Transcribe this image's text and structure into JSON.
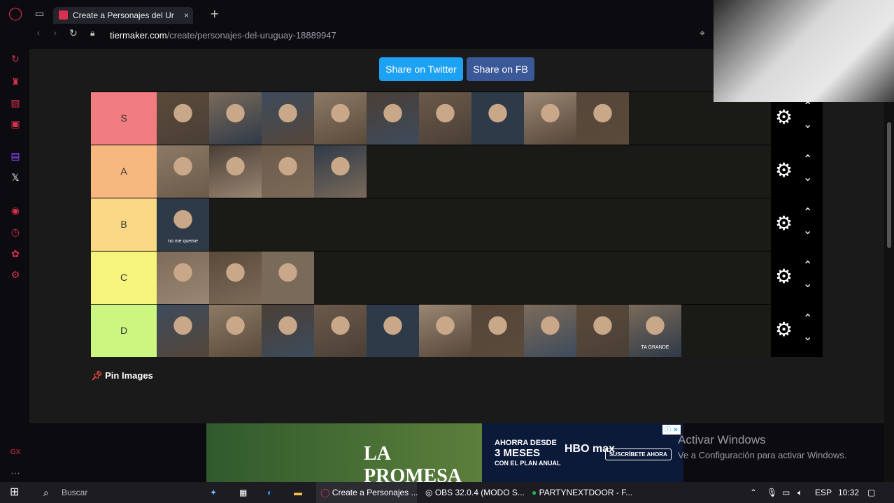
{
  "browser": {
    "tab_title": "Create a Personajes del Ur",
    "url_host": "tiermaker.com",
    "url_path": "/create/personajes-del-uruguay-18889947"
  },
  "page": {
    "share_twitter": "Share on Twitter",
    "share_fb": "Share on FB",
    "pin_images": "Pin Images"
  },
  "tiers": [
    {
      "label": "S",
      "color": "#f17d81",
      "count": 9
    },
    {
      "label": "A",
      "color": "#f7b880",
      "count": 4
    },
    {
      "label": "B",
      "color": "#fad884",
      "count": 1
    },
    {
      "label": "C",
      "color": "#f7f47e",
      "count": 3
    },
    {
      "label": "D",
      "color": "#cdf681",
      "count": 10
    }
  ],
  "thumb_captions": {
    "B": [
      "no me queme"
    ],
    "D": [
      "TA GRANDE"
    ]
  },
  "ad": {
    "title": "LA PROMESA",
    "promo_line1": "AHORRA DESDE",
    "promo_line2": "3 MESES",
    "promo_line3": "CON EL PLAN ANUAL",
    "brand": "HBO max",
    "cta": "SUSCRÍBETE AHORA"
  },
  "watermark": {
    "line1": "Activar Windows",
    "line2": "Ve a Configuración para activar Windows."
  },
  "taskbar": {
    "search": "Buscar",
    "apps": [
      "Create a Personajes ...",
      "OBS 32.0.4 (MODO S...",
      "PARTYNEXTDOOR - F..."
    ],
    "lang": "ESP",
    "time": "10:32"
  }
}
